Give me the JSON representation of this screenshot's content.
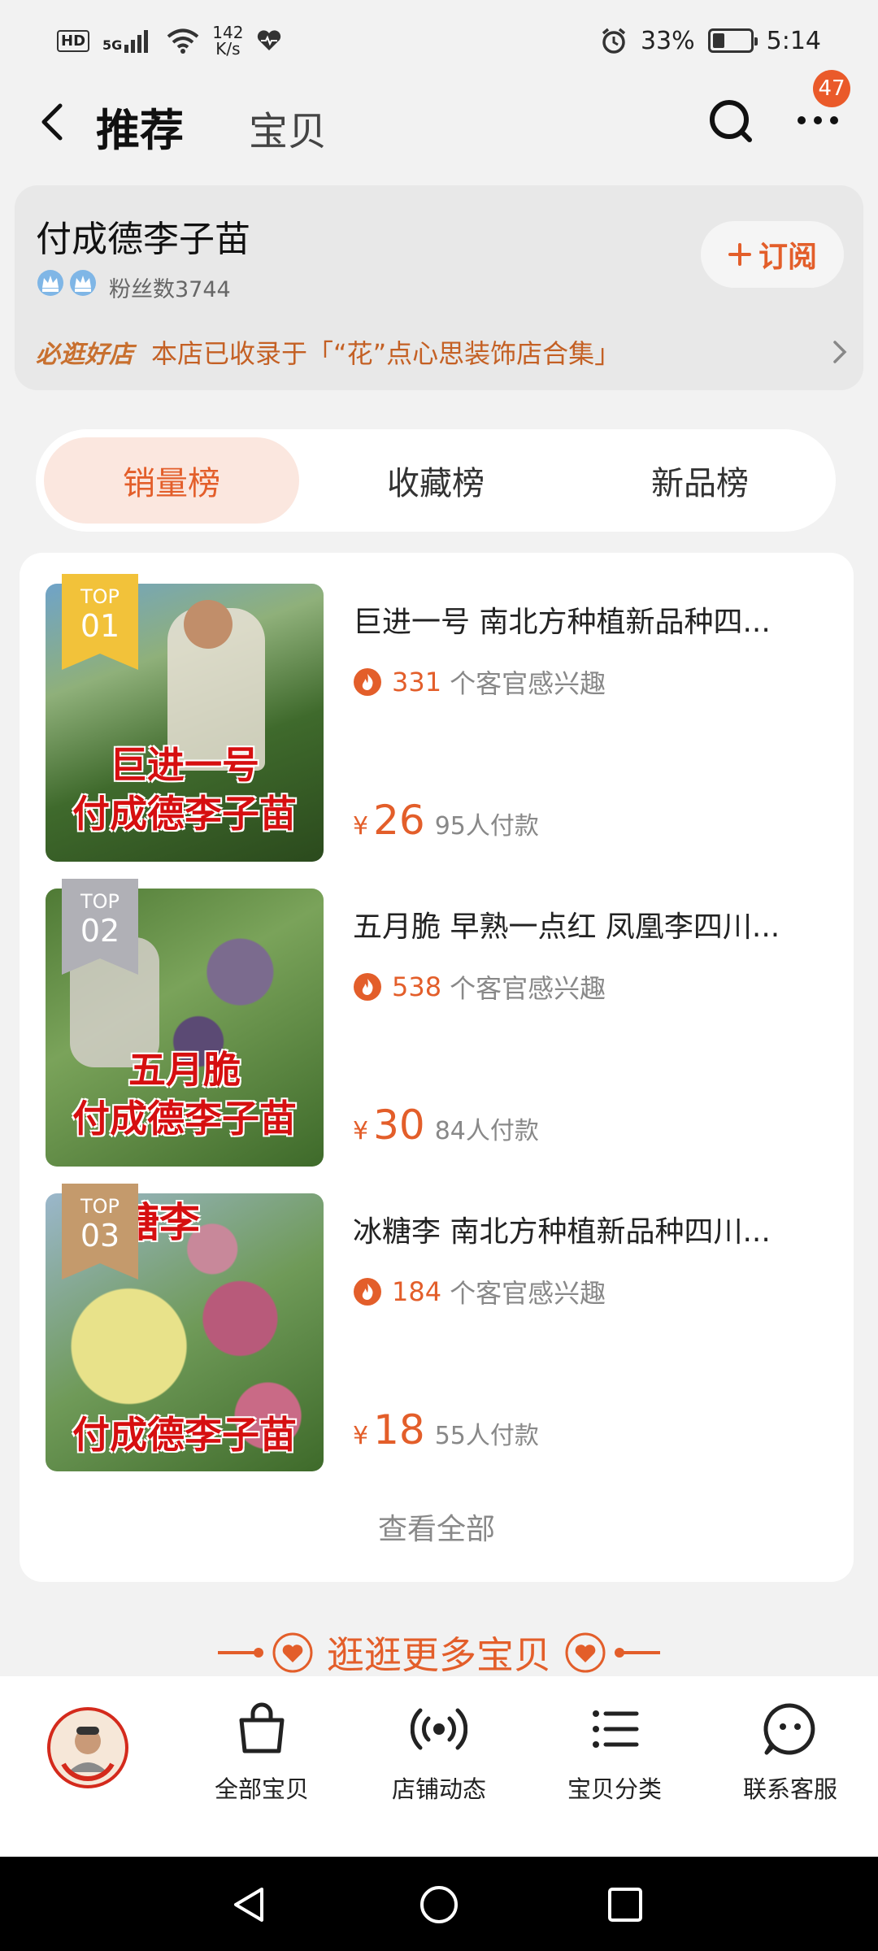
{
  "status_bar": {
    "hd": "HD",
    "network": "5G",
    "speed_value": "142",
    "speed_unit": "K/s",
    "battery_percent": "33%",
    "battery_level": 0.33,
    "time": "5:14"
  },
  "header": {
    "tab_active": "推荐",
    "tab_other": "宝贝",
    "badge_count": "47"
  },
  "shop": {
    "name": "付成德李子苗",
    "fans": "粉丝数3744",
    "subscribe_label": "订阅",
    "promo_tag": "必逛好店",
    "promo_text": "本店已收录于「“花”点心思装饰店合集」"
  },
  "rank_tabs": [
    {
      "label": "销量榜",
      "active": true
    },
    {
      "label": "收藏榜",
      "active": false
    },
    {
      "label": "新品榜",
      "active": false
    }
  ],
  "items": [
    {
      "rank_top": "TOP",
      "rank_num": "01",
      "badge_color": "#f2c23a",
      "caption_1": "巨进一号",
      "caption_2": "付成德李子苗",
      "title": "巨进一号 南北方种植新品种四...",
      "interest_count": "331",
      "interest_text": "个客官感兴趣",
      "currency": "¥",
      "price": "26",
      "paid": "95人付款"
    },
    {
      "rank_top": "TOP",
      "rank_num": "02",
      "badge_color": "#b0b0b6",
      "caption_1": "五月脆",
      "caption_2": "付成德李子苗",
      "title": "五月脆 早熟一点红 凤凰李四川...",
      "interest_count": "538",
      "interest_text": "个客官感兴趣",
      "currency": "¥",
      "price": "30",
      "paid": "84人付款"
    },
    {
      "rank_top": "TOP",
      "rank_num": "03",
      "badge_color": "#c49a6c",
      "caption_1": "糖李",
      "caption_2": "付成德李子苗",
      "title": "冰糖李 南北方种植新品种四川...",
      "interest_count": "184",
      "interest_text": "个客官感兴趣",
      "currency": "¥",
      "price": "18",
      "paid": "55人付款"
    }
  ],
  "view_all": "查看全部",
  "more_banner": "逛逛更多宝贝",
  "bottom_nav": [
    {
      "label": "全部宝贝",
      "icon": "bag-icon"
    },
    {
      "label": "店铺动态",
      "icon": "broadcast-icon"
    },
    {
      "label": "宝贝分类",
      "icon": "list-icon"
    },
    {
      "label": "联系客服",
      "icon": "chat-icon"
    }
  ],
  "colors": {
    "accent": "#e35e2a",
    "accent_light": "#fbe7df"
  }
}
